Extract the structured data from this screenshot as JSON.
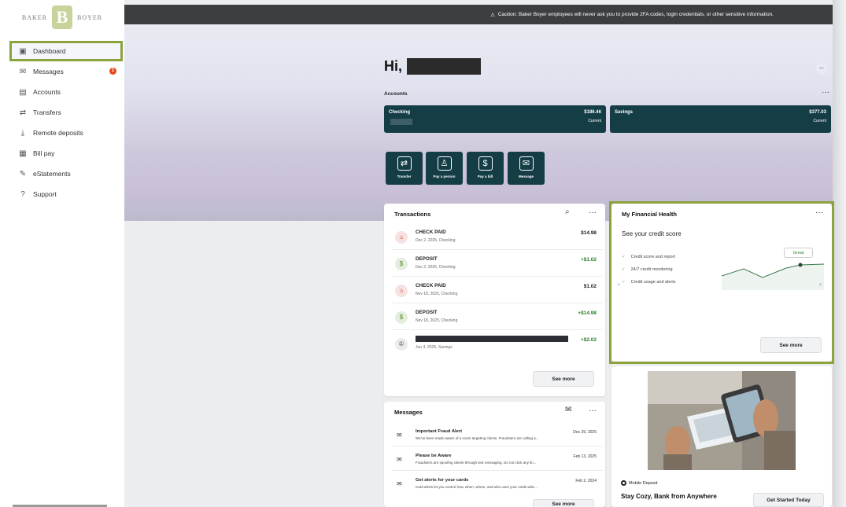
{
  "brand": {
    "left": "BAKER",
    "mark": "B",
    "right": "BOYER"
  },
  "banner": {
    "icon": "warning-icon",
    "text": "Caution: Baker Boyer employees will never ask you to provide 2FA codes, login credentials, or other sensitive information."
  },
  "sidebar": {
    "items": [
      {
        "label": "Dashboard",
        "icon": "dashboard-icon",
        "glyph": "▣"
      },
      {
        "label": "Messages",
        "icon": "envelope-icon",
        "glyph": "✉",
        "badge": "1"
      },
      {
        "label": "Accounts",
        "icon": "accounts-icon",
        "glyph": "▤"
      },
      {
        "label": "Transfers",
        "icon": "transfer-icon",
        "glyph": "⇄"
      },
      {
        "label": "Remote deposits",
        "icon": "remote-deposit-icon",
        "glyph": "⤓"
      },
      {
        "label": "Bill pay",
        "icon": "bill-icon",
        "glyph": "▦"
      },
      {
        "label": "eStatements",
        "icon": "statement-icon",
        "glyph": "✎"
      },
      {
        "label": "Support",
        "icon": "support-icon",
        "glyph": "?"
      }
    ]
  },
  "greeting": {
    "prefix": "Hi,"
  },
  "accounts": {
    "heading": "Accounts",
    "more": "···",
    "list": [
      {
        "name": "Checking",
        "balance": "$186.46",
        "status": "Current"
      },
      {
        "name": "Savings",
        "balance": "$377.03",
        "status": "Current"
      }
    ]
  },
  "quick_actions": [
    {
      "label": "Transfer",
      "icon": "transfer-icon",
      "glyph": "⇄"
    },
    {
      "label": "Pay a person",
      "icon": "person-icon",
      "glyph": "♙"
    },
    {
      "label": "Pay a bill",
      "icon": "bill-icon",
      "glyph": "$"
    },
    {
      "label": "Message",
      "icon": "message-icon",
      "glyph": "✉"
    }
  ],
  "transactions": {
    "title": "Transactions",
    "more": "···",
    "items": [
      {
        "name": "CHECK PAID",
        "sub": "Dec 2, 2025, Checking",
        "amount": "$14.98",
        "kind": "chk",
        "positive": false
      },
      {
        "name": "DEPOSIT",
        "sub": "Dec 2, 2025, Checking",
        "amount": "+$1.02",
        "kind": "dep",
        "positive": true
      },
      {
        "name": "CHECK PAID",
        "sub": "Nov 18, 2025, Checking",
        "amount": "$1.02",
        "kind": "chk",
        "positive": false
      },
      {
        "name": "DEPOSIT",
        "sub": "Nov 18, 2025, Checking",
        "amount": "+$14.98",
        "kind": "dep",
        "positive": true
      },
      {
        "name": "",
        "sub": "Jun 4, 2025, Savings",
        "amount": "+$2.02",
        "kind": "sav",
        "positive": true
      }
    ],
    "see_more": "See more"
  },
  "financial_health": {
    "title": "My Financial Health",
    "more": "···",
    "subtitle": "See your credit score",
    "features": [
      "Credit score and report",
      "24/7 credit monitoring",
      "Credit usage and alerts"
    ],
    "rating": "Great",
    "see_more": "See more"
  },
  "messages": {
    "title": "Messages",
    "more": "···",
    "items": [
      {
        "title": "Important Fraud Alert",
        "date": "Dec 29, 2025",
        "preview": "We've been made aware of a scam targeting clients. Fraudsters are calling a..."
      },
      {
        "title": "Please be Aware",
        "date": "Feb 13, 2025",
        "preview": "Fraudsters are spoofing clients through text messaging. Do not click any lin..."
      },
      {
        "title": "Get alerts for your cards",
        "date": "Feb 2, 2024",
        "preview": "Card alerts let you control how, when, where, and who uses your cards whic..."
      }
    ],
    "see_more": "See more"
  },
  "promo": {
    "kicker": "Mobile Deposit",
    "title": "Stay Cozy, Bank from Anywhere",
    "cta": "Get Started Today"
  }
}
